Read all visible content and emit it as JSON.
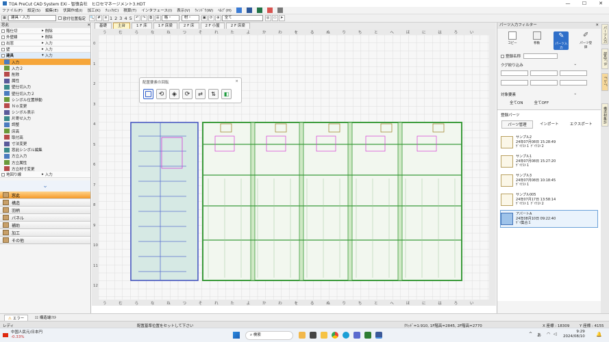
{
  "titlebar": {
    "title": "TOA PreCut CAD System EXi - 智慎会社　ヒロセマネージメント3.HDT"
  },
  "window_controls": {
    "min": "—",
    "max": "☐",
    "close": "✕"
  },
  "menu": [
    "ファイル(F)",
    "設定(S)",
    "編集(E)",
    "伏図作成(I)",
    "加工(K)",
    "ﾁｪｯｸ(C)",
    "積算(T)",
    "インタフェース(I)",
    "表示(V)",
    "ｳｨﾝﾄﾞｳ(W)",
    "ﾍﾙﾌﾟ(H)"
  ],
  "toolbar": {
    "mode_select": "建具・入力",
    "position_check": "欧付位置指定",
    "floor_numbers": [
      "1",
      "2",
      "3",
      "4",
      "5"
    ],
    "grid_label": "格・",
    "cut_label": "材・",
    "dock_label": "全て"
  },
  "floor_tabs": {
    "tabs": [
      "基礎",
      "土台",
      "1 F 床",
      "1 F 床梁",
      "2 F 床",
      "2 F 小屋",
      "2 F 床梁"
    ],
    "selected": 1
  },
  "left_panel": {
    "header": "窓此",
    "sections": [
      {
        "label": "階仕切",
        "action": "削除"
      },
      {
        "label": "外壁線",
        "action": "削除"
      },
      {
        "label": "出窓",
        "action": "入力"
      },
      {
        "label": "壁",
        "action": "入力"
      },
      {
        "label": "建具",
        "action": "入力"
      }
    ],
    "commands": [
      "入力",
      "入力２",
      "削除",
      "属性",
      "壁仕切入力",
      "壁仕切入力２",
      "シンボル位置移動",
      "Ｎｏ変更",
      "シンボル表示",
      "片寄せ入力",
      "調整",
      "床高",
      "取付高",
      "寸法変更",
      "窓此シンボル編集",
      "方立入力",
      "方立属性",
      "方立材寸変更"
    ],
    "selected_command": 0,
    "bottom_section": {
      "label": "地回り線",
      "action": "入力"
    },
    "nav": [
      "窓此",
      "構造",
      "羽柄",
      "パネル",
      "補助",
      "加工",
      "その他"
    ],
    "selected_nav": 0
  },
  "canvas": {
    "ruler_top": [
      "う",
      "む",
      "ら",
      "な",
      "ね",
      "つ",
      "そ",
      "れ",
      "た",
      "よ",
      "か",
      "わ",
      "を",
      "る",
      "ぬ",
      "り",
      "ち",
      "と",
      "へ",
      "ほ",
      "に",
      "は",
      "ろ",
      "い"
    ],
    "ruler_bottom": [
      "う",
      "む",
      "ら",
      "な",
      "ね",
      "つ",
      "そ",
      "れ",
      "た",
      "よ",
      "か",
      "わ",
      "を",
      "る",
      "ぬ",
      "り",
      "ち",
      "と",
      "へ",
      "ほ",
      "に",
      "は",
      "ろ",
      "い"
    ],
    "ruler_left": [
      "0",
      "1",
      "2",
      "3",
      "4",
      "5",
      "6",
      "7",
      "8",
      "9",
      "10",
      "11",
      "12"
    ]
  },
  "dialog": {
    "title": "配置要素の回転",
    "close": "×"
  },
  "right_panel": {
    "title": "パーツ入力フィルター",
    "tools": [
      "コピー",
      "移動",
      "パーツ入力",
      "パーツ登録"
    ],
    "reg_name_label": "登録名称",
    "search_label": "クグ絞り込み",
    "target_label": "対象要素",
    "all_on": "全てON",
    "all_off": "全てOFF",
    "reg_parts_label": "登録パーツ",
    "buttons": [
      "パーツ管理",
      "インポート",
      "エクスポート"
    ],
    "parts": [
      {
        "name": "サンプル2",
        "date": "24年07月08日 15:28:49",
        "desc": "ｹﾞｲﾃｽﾄ１ ｹﾞｲﾃｽﾄ２"
      },
      {
        "name": "サンプル1",
        "date": "24年07月08日 15:27:20",
        "desc": "ｹﾞｲﾃｽﾄ１"
      },
      {
        "name": "サンプル3",
        "date": "24年07月08日 10:18:45",
        "desc": "ｹﾞｲﾃｽﾄ１"
      },
      {
        "name": "サンプル005",
        "date": "24年07月17日 13:58:14",
        "desc": "ｹﾞｲﾃｽﾄ１ ｹﾞｲﾃｽﾄ２"
      },
      {
        "name": "アパートA",
        "date": "24年08月10日 09:22:40",
        "desc": "ｹﾞｲ集合１"
      }
    ],
    "selected_part": 4
  },
  "side_tabs": [
    "パーツ入力",
    "部品ﾊﾟﾈﾙ",
    "ｸﾞﾙｰﾌﾟ",
    "構造材集計"
  ],
  "statusbar": {
    "tab_error": "エラー",
    "tab_structure": "構造端ﾘｽﾄ"
  },
  "statusbar2": {
    "ready": "レディ",
    "message": "配置基準位置をセットして下さい",
    "coords": "ｸﾘｯﾄﾞ=1:910, 1F階高=2845, 2F階高=2770",
    "x_coord": "X 座標 : 18309",
    "y_coord": "Y 座標 : 4155"
  },
  "taskbar": {
    "currency": "中国人民元/日本円",
    "change": "-0.33%",
    "search": "検索",
    "time": "9:29",
    "date": "2024/08/10",
    "lang": "あ"
  },
  "colors": {
    "accent": "#f6a63a",
    "timber": "#3a9a3a",
    "selected_frame": "#3f4fbf",
    "highlight": "#d43ad4"
  }
}
